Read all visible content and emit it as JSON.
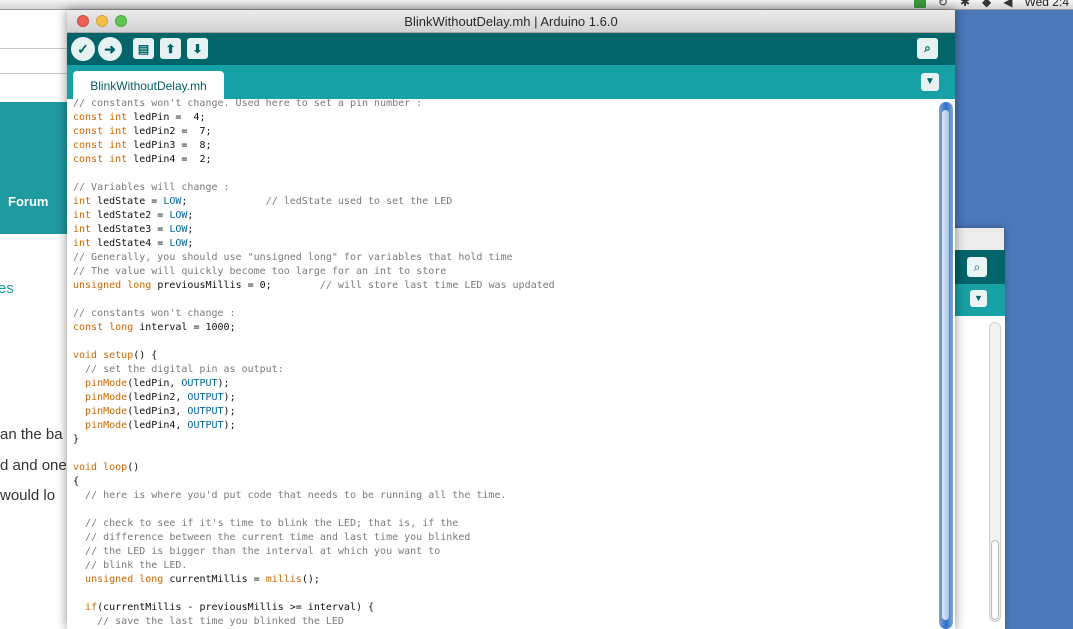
{
  "menubar": {
    "clock": "Wed 2:4"
  },
  "background_page": {
    "nav_forum": "Forum",
    "frag_es": "es",
    "text_lines": [
      "an the ba",
      "d and one",
      " would lo"
    ]
  },
  "window": {
    "title": "BlinkWithoutDelay.mh | Arduino 1.6.0",
    "toolbar": {
      "verify": "✓",
      "upload": "➜",
      "new": "▤",
      "open": "⬆",
      "save": "⬇",
      "serial_monitor": "⌕"
    },
    "tab_label": "BlinkWithoutDelay.mh",
    "tab_menu": "▼"
  },
  "code_lines": [
    [
      [
        "cm",
        "// constants won't change. Used here to set a pin number :"
      ]
    ],
    [
      [
        "kw",
        "const"
      ],
      [
        "tx",
        " "
      ],
      [
        "kw",
        "int"
      ],
      [
        "tx",
        " ledPin =  4;"
      ]
    ],
    [
      [
        "kw",
        "const"
      ],
      [
        "tx",
        " "
      ],
      [
        "kw",
        "int"
      ],
      [
        "tx",
        " ledPin2 =  7;"
      ]
    ],
    [
      [
        "kw",
        "const"
      ],
      [
        "tx",
        " "
      ],
      [
        "kw",
        "int"
      ],
      [
        "tx",
        " ledPin3 =  8;"
      ]
    ],
    [
      [
        "kw",
        "const"
      ],
      [
        "tx",
        " "
      ],
      [
        "kw",
        "int"
      ],
      [
        "tx",
        " ledPin4 =  2;"
      ]
    ],
    [],
    [
      [
        "cm",
        "// Variables will change :"
      ]
    ],
    [
      [
        "kw",
        "int"
      ],
      [
        "tx",
        " ledState = "
      ],
      [
        "const",
        "LOW"
      ],
      [
        "tx",
        ";             "
      ],
      [
        "cm",
        "// ledState used to set the LED"
      ]
    ],
    [
      [
        "kw",
        "int"
      ],
      [
        "tx",
        " ledState2 = "
      ],
      [
        "const",
        "LOW"
      ],
      [
        "tx",
        ";"
      ]
    ],
    [
      [
        "kw",
        "int"
      ],
      [
        "tx",
        " ledState3 = "
      ],
      [
        "const",
        "LOW"
      ],
      [
        "tx",
        ";"
      ]
    ],
    [
      [
        "kw",
        "int"
      ],
      [
        "tx",
        " ledState4 = "
      ],
      [
        "const",
        "LOW"
      ],
      [
        "tx",
        ";"
      ]
    ],
    [
      [
        "cm",
        "// Generally, you should use \"unsigned long\" for variables that hold time"
      ]
    ],
    [
      [
        "cm",
        "// The value will quickly become too large for an int to store"
      ]
    ],
    [
      [
        "kw",
        "unsigned"
      ],
      [
        "tx",
        " "
      ],
      [
        "kw",
        "long"
      ],
      [
        "tx",
        " previousMillis = 0;        "
      ],
      [
        "cm",
        "// will store last time LED was updated"
      ]
    ],
    [],
    [
      [
        "cm",
        "// constants won't change :"
      ]
    ],
    [
      [
        "kw",
        "const"
      ],
      [
        "tx",
        " "
      ],
      [
        "kw",
        "long"
      ],
      [
        "tx",
        " interval = 1000;"
      ]
    ],
    [],
    [
      [
        "kw",
        "void"
      ],
      [
        "tx",
        " "
      ],
      [
        "fn",
        "setup"
      ],
      [
        "tx",
        "() {"
      ]
    ],
    [
      [
        "tx",
        "  "
      ],
      [
        "cm",
        "// set the digital pin as output:"
      ]
    ],
    [
      [
        "tx",
        "  "
      ],
      [
        "fn",
        "pinMode"
      ],
      [
        "tx",
        "(ledPin, "
      ],
      [
        "const",
        "OUTPUT"
      ],
      [
        "tx",
        ");"
      ]
    ],
    [
      [
        "tx",
        "  "
      ],
      [
        "fn",
        "pinMode"
      ],
      [
        "tx",
        "(ledPin2, "
      ],
      [
        "const",
        "OUTPUT"
      ],
      [
        "tx",
        ");"
      ]
    ],
    [
      [
        "tx",
        "  "
      ],
      [
        "fn",
        "pinMode"
      ],
      [
        "tx",
        "(ledPin3, "
      ],
      [
        "const",
        "OUTPUT"
      ],
      [
        "tx",
        ");"
      ]
    ],
    [
      [
        "tx",
        "  "
      ],
      [
        "fn",
        "pinMode"
      ],
      [
        "tx",
        "(ledPin4, "
      ],
      [
        "const",
        "OUTPUT"
      ],
      [
        "tx",
        ");"
      ]
    ],
    [
      [
        "tx",
        "}"
      ]
    ],
    [],
    [
      [
        "kw",
        "void"
      ],
      [
        "tx",
        " "
      ],
      [
        "fn",
        "loop"
      ],
      [
        "tx",
        "()"
      ]
    ],
    [
      [
        "tx",
        "{"
      ]
    ],
    [
      [
        "tx",
        "  "
      ],
      [
        "cm",
        "// here is where you'd put code that needs to be running all the time."
      ]
    ],
    [],
    [
      [
        "tx",
        "  "
      ],
      [
        "cm",
        "// check to see if it's time to blink the LED; that is, if the"
      ]
    ],
    [
      [
        "tx",
        "  "
      ],
      [
        "cm",
        "// difference between the current time and last time you blinked"
      ]
    ],
    [
      [
        "tx",
        "  "
      ],
      [
        "cm",
        "// the LED is bigger than the interval at which you want to"
      ]
    ],
    [
      [
        "tx",
        "  "
      ],
      [
        "cm",
        "// blink the LED."
      ]
    ],
    [
      [
        "tx",
        "  "
      ],
      [
        "kw",
        "unsigned"
      ],
      [
        "tx",
        " "
      ],
      [
        "kw",
        "long"
      ],
      [
        "tx",
        " currentMillis = "
      ],
      [
        "fn",
        "millis"
      ],
      [
        "tx",
        "();"
      ]
    ],
    [],
    [
      [
        "tx",
        "  "
      ],
      [
        "kw",
        "if"
      ],
      [
        "tx",
        "(currentMillis - previousMillis >= interval) {"
      ]
    ],
    [
      [
        "tx",
        "    "
      ],
      [
        "cm",
        "// save the last time you blinked the LED"
      ]
    ]
  ]
}
